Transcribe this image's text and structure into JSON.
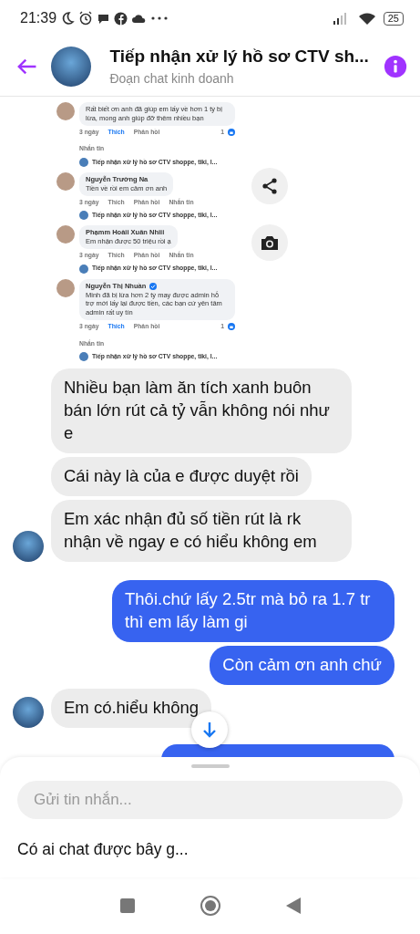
{
  "status_bar": {
    "time": "21:39",
    "battery": "25"
  },
  "header": {
    "title": "Tiếp nhận xử lý hồ sơ CTV sh...",
    "subtitle": "Đoạn chat kinh doanh"
  },
  "shared_screenshot": {
    "comments": [
      {
        "text": "Rất biết ơn anh đã giúp em lấy về hơn 1 tỷ bị lừa, mong anh giúp đỡ thêm nhiều bạn",
        "time": "3 ngày",
        "like": "Thích",
        "liked": true,
        "reply": "Phản hồi",
        "reactions": "1",
        "message": "Nhắn tin",
        "reply_preview": "Tiếp nhận xử lý hồ sơ CTV shoppe, tiki, l..."
      },
      {
        "name": "Nguyễn Trường Na",
        "text": "Tiền về rồi em cảm ơn anh",
        "time": "3 ngày",
        "like": "Thích",
        "liked": false,
        "reply": "Phản hồi",
        "message": "Nhắn tin",
        "reply_preview": "Tiếp nhận xử lý hồ sơ CTV shoppe, tiki, l..."
      },
      {
        "name": "Phạmm Hoàii Xuân Nhiii",
        "text": "Em nhận được 50 triệu rồi ạ",
        "time": "3 ngày",
        "like": "Thích",
        "liked": false,
        "reply": "Phản hồi",
        "message": "Nhắn tin",
        "reply_preview": "Tiếp nhận xử lý hồ sơ CTV shoppe, tiki, l..."
      },
      {
        "name": "Nguyễn Thị Nhuần",
        "verified": true,
        "text": "Minh đã bị lừa hơn 2 tỷ may được admin hỗ trợ mới lấy lại được tiền, các bạn cứ yên tâm admin rất uy tín",
        "time": "3 ngày",
        "like": "Thích",
        "liked": true,
        "reply": "Phản hồi",
        "reactions": "1",
        "message": "Nhắn tin",
        "reply_preview": "Tiếp nhận xử lý hồ sơ CTV shoppe, tiki, l..."
      }
    ]
  },
  "messages": [
    {
      "kind": "received",
      "text": "Nhiều bạn làm ăn tích xanh buôn bán lớn rút cả tỷ vẫn không nói như e",
      "avatar": false
    },
    {
      "kind": "received",
      "text": "Cái này là của e được duyệt rồi",
      "avatar": false
    },
    {
      "kind": "received",
      "text": "Em xác nhận đủ số tiền rút là rk nhận về ngay e có hiểu không em",
      "avatar": true
    },
    {
      "kind": "sent",
      "text": "Thôi.chứ lấy 2.5tr mà bỏ ra 1.7 tr thì em lấy làm gi"
    },
    {
      "kind": "sent",
      "text": "Còn cảm ơn anh chứ"
    },
    {
      "kind": "received",
      "text": "Em có.hiểu không",
      "avatar": true
    }
  ],
  "composer": {
    "placeholder": "Gửi tin nhắn..."
  },
  "suggestion": "Có ai chat được bây g..."
}
